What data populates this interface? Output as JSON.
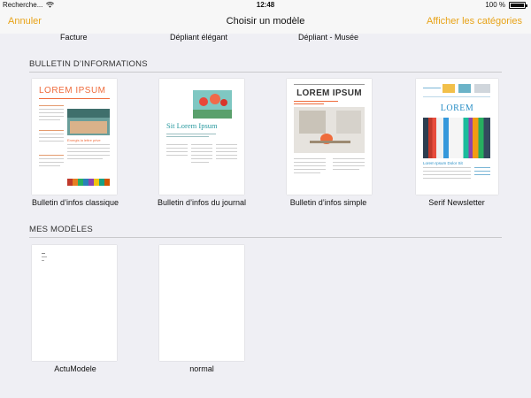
{
  "status_bar": {
    "carrier": "Recherche...",
    "time": "12:48",
    "battery_text": "100 %",
    "battery_level": 1.0
  },
  "nav": {
    "cancel": "Annuler",
    "title": "Choisir un modèle",
    "show_categories": "Afficher les catégories"
  },
  "previous_row": [
    "Facture",
    "Dépliant élégant",
    "Dépliant - Musée"
  ],
  "sections": [
    {
      "header": "BULLETIN D’INFORMATIONS",
      "templates": [
        {
          "label": "Bulletin d’infos classique",
          "thumb_title": "LOREM IPSUM",
          "thumb_headline": "Enregis la lettre prive"
        },
        {
          "label": "Bulletin d’infos du journal",
          "thumb_title": "Sit Lorem Ipsum"
        },
        {
          "label": "Bulletin d’infos simple",
          "thumb_title": "LOREM IPSUM"
        },
        {
          "label": "Serif Newsletter",
          "thumb_title": "LOREM",
          "thumb_subtitle": "Lorem Ipsum Dolor Sit"
        }
      ]
    },
    {
      "header": "MES MODÈLES",
      "templates": [
        {
          "label": "ActuModele"
        },
        {
          "label": "normal"
        }
      ]
    }
  ],
  "colors": {
    "accent": "#e8a318",
    "background": "#efeff4",
    "bar": "#f7f7f7",
    "lorem_orange": "#ef6c3c",
    "serif_blue": "#2a8fc6"
  }
}
